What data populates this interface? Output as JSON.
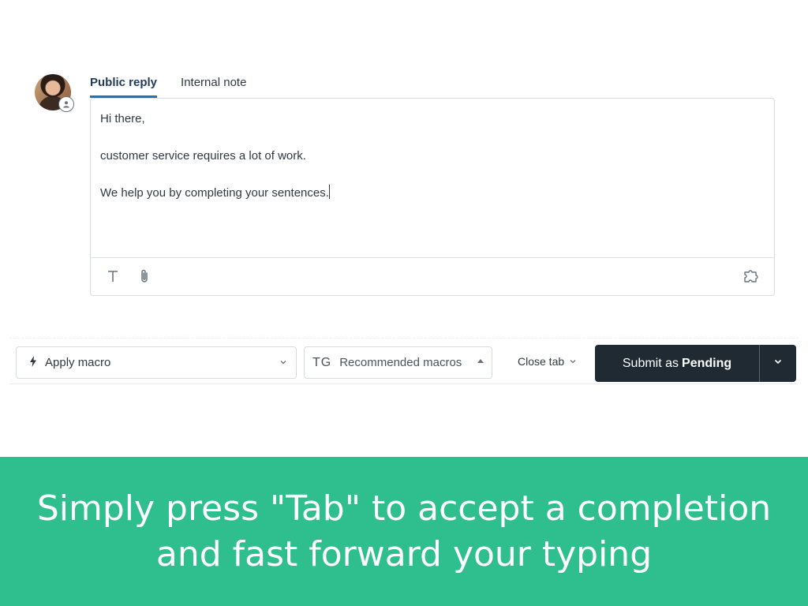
{
  "composer": {
    "tabs": [
      {
        "label": "Public reply",
        "active": true
      },
      {
        "label": "Internal note",
        "active": false
      }
    ],
    "body_lines": [
      "Hi there,",
      "customer service requires a lot of work.",
      "We help you by completing your sentences."
    ],
    "toolbar_icons": [
      "text-format-icon",
      "paperclip-icon",
      "puzzle-icon"
    ]
  },
  "footer": {
    "apply_macro_label": "Apply macro",
    "recommended_prefix": "TG",
    "recommended_label": "Recommended macros",
    "close_tab_label": "Close tab",
    "submit_prefix": "Submit as",
    "submit_status": "Pending"
  },
  "banner": {
    "line1": "Simply press \"Tab\" to accept a completion",
    "line2": "and fast forward your typing"
  },
  "colors": {
    "accent": "#1f73b7",
    "submit_bg": "#1f2a33",
    "banner_bg": "#2fbf8e"
  }
}
